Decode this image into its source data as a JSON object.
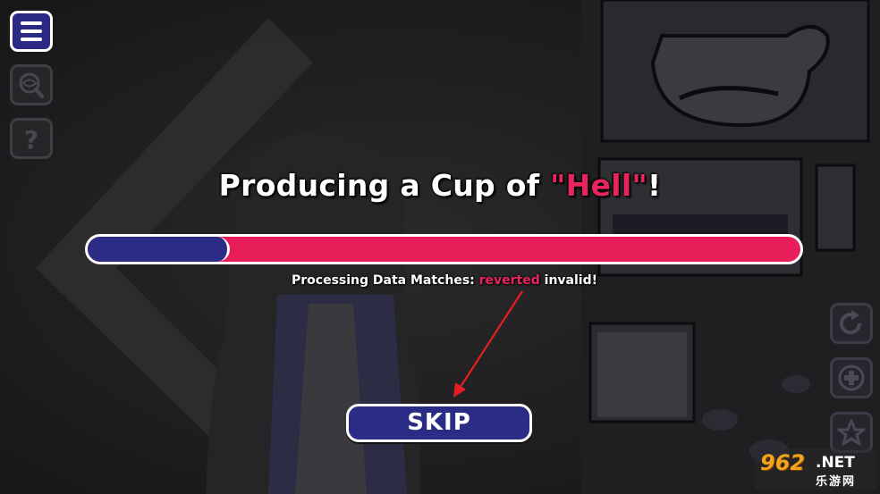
{
  "toolbar_left": [
    {
      "icon": "menu-icon",
      "state": "active"
    },
    {
      "icon": "magnifier-eye-icon",
      "state": "dimmed"
    },
    {
      "icon": "question-icon",
      "state": "dimmed"
    }
  ],
  "toolbar_right": [
    {
      "icon": "refresh-icon"
    },
    {
      "icon": "plus-icon"
    },
    {
      "icon": "star-icon"
    }
  ],
  "title": {
    "prefix": "Producing a Cup of ",
    "highlight": "\"Hell\"",
    "suffix": "!"
  },
  "progress": {
    "fraction": 0.2
  },
  "status": {
    "prefix": "Processing Data Matches: ",
    "highlight": "reverted",
    "suffix": " invalid!"
  },
  "skip_button": {
    "label": "SKIP"
  },
  "watermark": {
    "logo": "962",
    "domain": ".NET",
    "subtitle": "乐游网"
  },
  "colors": {
    "accent": "#e81e5a",
    "button_fill": "#2b2c86",
    "annotation_arrow": "#e41d25"
  }
}
